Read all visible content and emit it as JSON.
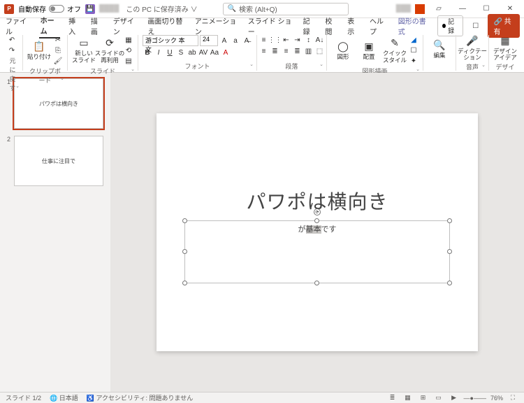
{
  "titlebar": {
    "autosave_label": "自動保存",
    "autosave_state": "オフ",
    "doc_title": "この PC に保存済み ∨",
    "search_placeholder": "検索 (Alt+Q)"
  },
  "tabs": {
    "file": "ファイル",
    "home": "ホーム",
    "insert": "挿入",
    "draw": "描画",
    "design": "デザイン",
    "transitions": "画面切り替え",
    "animations": "アニメーション",
    "slideshow": "スライド ショー",
    "record": "記録",
    "review": "校閲",
    "view": "表示",
    "help": "ヘルプ",
    "shapeformat": "図形の書式",
    "record_btn": "記録",
    "share_btn": "共有"
  },
  "ribbon": {
    "undo_group": "元に戻す",
    "paste": "貼り付け",
    "clipboard_group": "クリップボード",
    "new_slide": "新しい\nスライド",
    "reuse": "スライドの\n再利用",
    "slides_group": "スライド",
    "font_name": "游ゴシック 本文",
    "font_size": "24",
    "font_group": "フォント",
    "para_group": "段落",
    "shape": "図形",
    "arrange": "配置",
    "quickstyle": "クイック\nスタイル",
    "drawing_group": "図形描画",
    "editing": "編集",
    "dictate": "ディクテー\nション",
    "voice_group": "音声",
    "designer": "デザイン\nアイデア",
    "designer_group": "デザイナー"
  },
  "thumbs": [
    {
      "num": "1",
      "title": "パワポは横向き",
      "sub": ""
    },
    {
      "num": "2",
      "title": "仕事に注目で",
      "sub": ""
    }
  ],
  "slide": {
    "title": "パワポは横向き",
    "subtitle_pre": "が",
    "subtitle_sel": "基本",
    "subtitle_post": "です"
  },
  "status": {
    "slide": "スライド 1/2",
    "lang": "日本語",
    "access": "アクセシビリティ: 問題ありません",
    "zoom": "76%"
  }
}
